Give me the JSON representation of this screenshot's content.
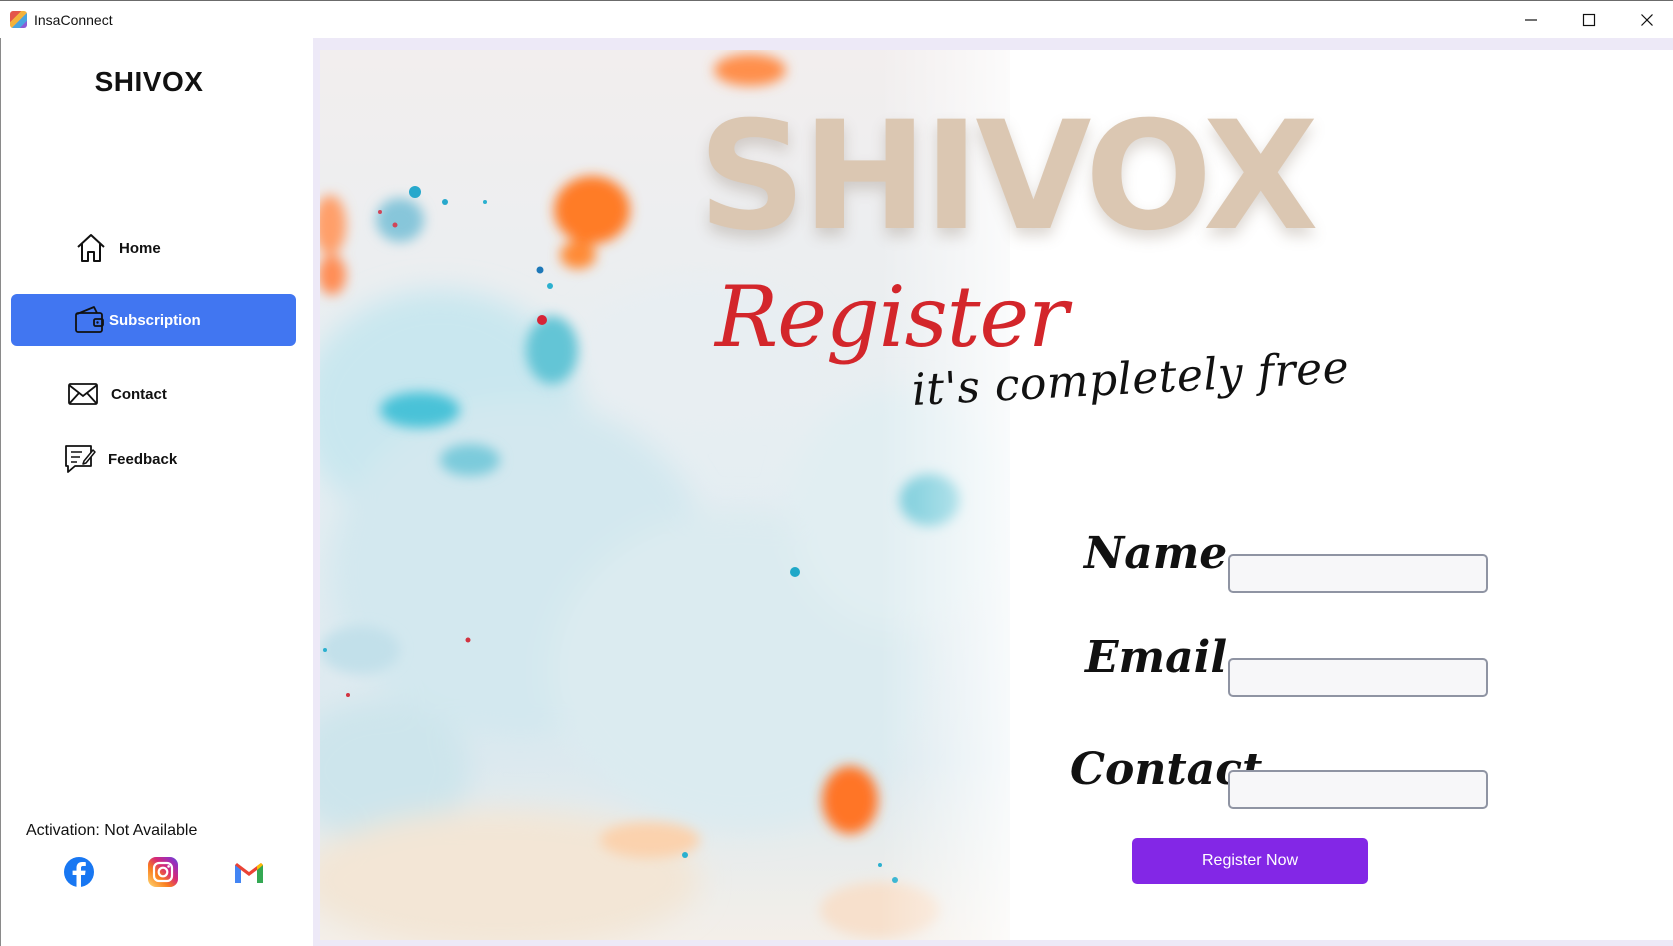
{
  "window": {
    "title": "InsaConnect",
    "controls": {
      "minimize_icon": "minimize-icon",
      "maximize_icon": "maximize-icon",
      "close_icon": "close-icon"
    }
  },
  "sidebar": {
    "brand": "SHIVOX",
    "items": [
      {
        "label": "Home",
        "icon": "home-icon",
        "active": false
      },
      {
        "label": "Subscription",
        "icon": "wallet-icon",
        "active": true
      },
      {
        "label": "Contact",
        "icon": "mail-icon",
        "active": false
      },
      {
        "label": "Feedback",
        "icon": "feedback-icon",
        "active": false
      }
    ],
    "activation": "Activation: Not Available",
    "social": [
      {
        "name": "facebook-icon",
        "color": "#1877f2"
      },
      {
        "name": "instagram-icon",
        "color": "#e1306c"
      },
      {
        "name": "gmail-icon",
        "color": "#ea4335"
      }
    ],
    "active_color": "#4176f1"
  },
  "register": {
    "brand_watermark": "SHIVOX",
    "title": "Register",
    "tagline": "it's completely free",
    "fields": [
      {
        "label": "Name",
        "value": ""
      },
      {
        "label": "Email",
        "value": ""
      },
      {
        "label": "Contact",
        "value": ""
      }
    ],
    "submit_label": "Register Now",
    "accent_red": "#d3262b",
    "button_color": "#8327e6"
  }
}
